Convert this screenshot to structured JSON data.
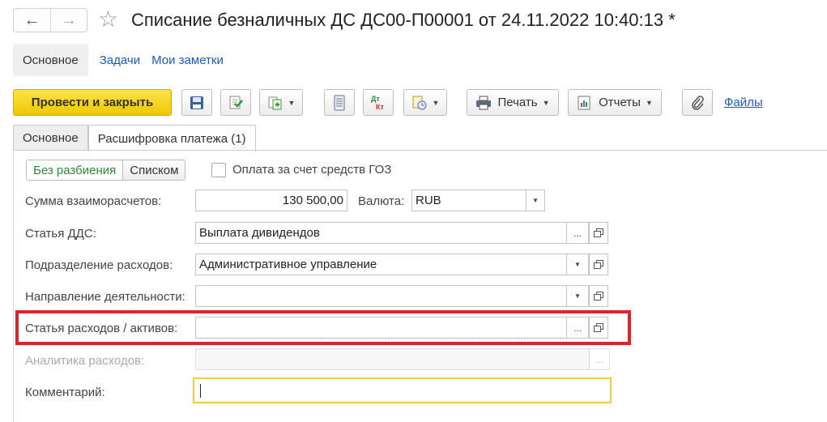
{
  "window": {
    "title": "Списание безналичных ДС ДС00-П00001 от 24.11.2022 10:40:13 *",
    "back_icon": "arrow-left-icon",
    "forward_icon": "arrow-right-icon",
    "favorite_icon": "star-icon"
  },
  "sections": {
    "active": "Основное",
    "links": [
      "Задачи",
      "Мои заметки"
    ]
  },
  "toolbar": {
    "post_close": "Провести и закрыть",
    "print": "Печать",
    "reports": "Отчеты",
    "files": "Файлы"
  },
  "tabs": {
    "main": "Основное",
    "payment": "Расшифровка платежа (1)"
  },
  "split": {
    "option_no_split": "Без разбиения",
    "option_list": "Списком",
    "goz_label": "Оплата за счет средств ГОЗ",
    "goz_checked": false
  },
  "form": {
    "amount_label": "Сумма взаиморасчетов:",
    "amount_value": "130 500,00",
    "currency_label": "Валюта:",
    "currency_value": "RUB",
    "dds_label": "Статья ДДС:",
    "dds_value": "Выплата дивидендов",
    "dept_label": "Подразделение расходов:",
    "dept_value": "Административное управление",
    "direction_label": "Направление деятельности:",
    "direction_value": "",
    "expense_label": "Статья расходов / активов:",
    "expense_value": "",
    "analytics_label": "Аналитика расходов:",
    "analytics_value": "",
    "comment_label": "Комментарий:",
    "comment_value": "",
    "select_button": "...",
    "highlight_color": "#d9252b",
    "primary_color": "#f5d21a"
  }
}
